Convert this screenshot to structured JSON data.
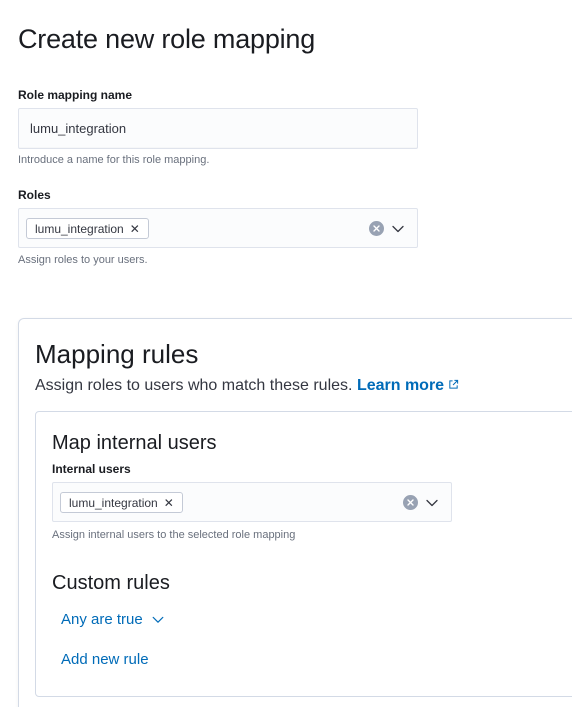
{
  "page": {
    "title": "Create new role mapping"
  },
  "role_mapping_name": {
    "label": "Role mapping name",
    "value": "lumu_integration",
    "help": "Introduce a name for this role mapping."
  },
  "roles": {
    "label": "Roles",
    "selected": [
      "lumu_integration"
    ],
    "help": "Assign roles to your users."
  },
  "mapping_rules": {
    "title": "Mapping rules",
    "description": "Assign roles to users who match these rules.",
    "learn_more_label": "Learn more",
    "internal_users": {
      "section_title": "Map internal users",
      "label": "Internal users",
      "selected": [
        "lumu_integration"
      ],
      "help": "Assign internal users to the selected role mapping"
    },
    "custom_rules": {
      "title": "Custom rules",
      "operator_label": "Any are true",
      "add_rule_label": "Add new rule"
    }
  },
  "icons": {
    "pill_remove": "cross-icon",
    "clear": "clear-circle-icon",
    "dropdown": "chevron-down-icon",
    "external_link": "external-link-icon"
  },
  "colors": {
    "link": "#006bb8",
    "text": "#343741",
    "heading": "#1a1c21",
    "help": "#69707d",
    "border": "#d3dae6",
    "input_bg": "#fbfcfd",
    "clear_bg": "#98a2b3"
  }
}
